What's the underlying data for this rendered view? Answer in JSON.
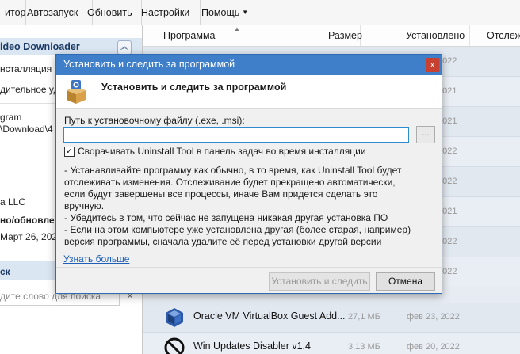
{
  "toolbar": {
    "items": [
      {
        "label": "итор",
        "icon": "monitor-icon"
      },
      {
        "label": "Автозапуск",
        "icon": "autorun-icon"
      },
      {
        "label": "Обновить",
        "icon": "refresh-icon"
      },
      {
        "label": "Настройки",
        "icon": "settings-icon"
      },
      {
        "label": "Помощь",
        "icon": "help-icon"
      }
    ]
  },
  "sidebar": {
    "app_title": "ideo Downloader",
    "lines": [
      "нсталляция",
      "дительное уд",
      "gram",
      "\\Download\\4",
      "a LLC"
    ],
    "bold_line": "но/обновлен",
    "date": "Март 26, 2022",
    "search_label": "ск",
    "search_placeholder": "дите слово для поиска",
    "search_clear": "×"
  },
  "list": {
    "columns": {
      "program": "Программа",
      "size": "Размер",
      "installed": "Установлено",
      "traced": "Отслеж"
    },
    "bg_years": [
      "2022",
      "2021",
      "2021",
      "2022",
      "2022",
      "2021",
      "2022",
      "2022"
    ],
    "rows": [
      {
        "name": "Oracle VM VirtualBox Guest Add...",
        "size": "27,1 МБ",
        "date": "фев 23, 2022",
        "icon": "virtualbox-icon"
      },
      {
        "name": "Win Updates Disabler v1.4",
        "size": "3,13 МБ",
        "date": "фев 20, 2022",
        "icon": "disabler-icon"
      }
    ]
  },
  "dialog": {
    "window_title": "Установить и следить за программой",
    "close_glyph": "x",
    "header_title": "Установить и следить за программой",
    "path_label": "Путь к установочному файлу (.exe, .msi):",
    "path_value": "",
    "browse_label": "...",
    "checkbox_label": "Сворачивать Uninstall Tool в панель задач во время инсталляции",
    "checkbox_checked": true,
    "checkbox_mark": "✓",
    "info_lines": [
      "- Устанавливайте программу как обычно, в то время, как Uninstall Tool будет",
      "отслеживать изменения. Отслеживание будет прекращено автоматически,",
      "если будут завершены все процессы, иначе Вам придется сделать это",
      "вручную.",
      "- Убедитесь в том, что сейчас не запущена никакая другая установка ПО",
      "- Если на этом компьютере уже установлена другая (более старая, например)",
      "версия программы, сначала удалите её перед установки другой версии"
    ],
    "learn_more": "Узнать больше",
    "install_button": "Установить и следить",
    "cancel_button": "Отмена"
  }
}
